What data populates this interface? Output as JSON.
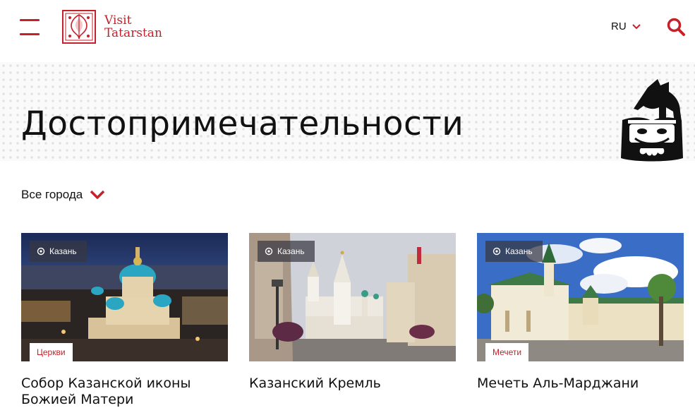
{
  "brand": {
    "line1": "Visit",
    "line2": "Tatarstan",
    "color": "#c8202b"
  },
  "header": {
    "language": "RU"
  },
  "page": {
    "title": "Достопримечательности"
  },
  "filter": {
    "city": "Все города"
  },
  "cards": [
    {
      "location": "Казань",
      "tag": "Церкви",
      "title": "Собор Казанской иконы Божией Матери"
    },
    {
      "location": "Казань",
      "tag": "",
      "title": "Казанский Кремль"
    },
    {
      "location": "Казань",
      "tag": "Мечети",
      "title": "Мечеть Аль-Марджани"
    }
  ]
}
